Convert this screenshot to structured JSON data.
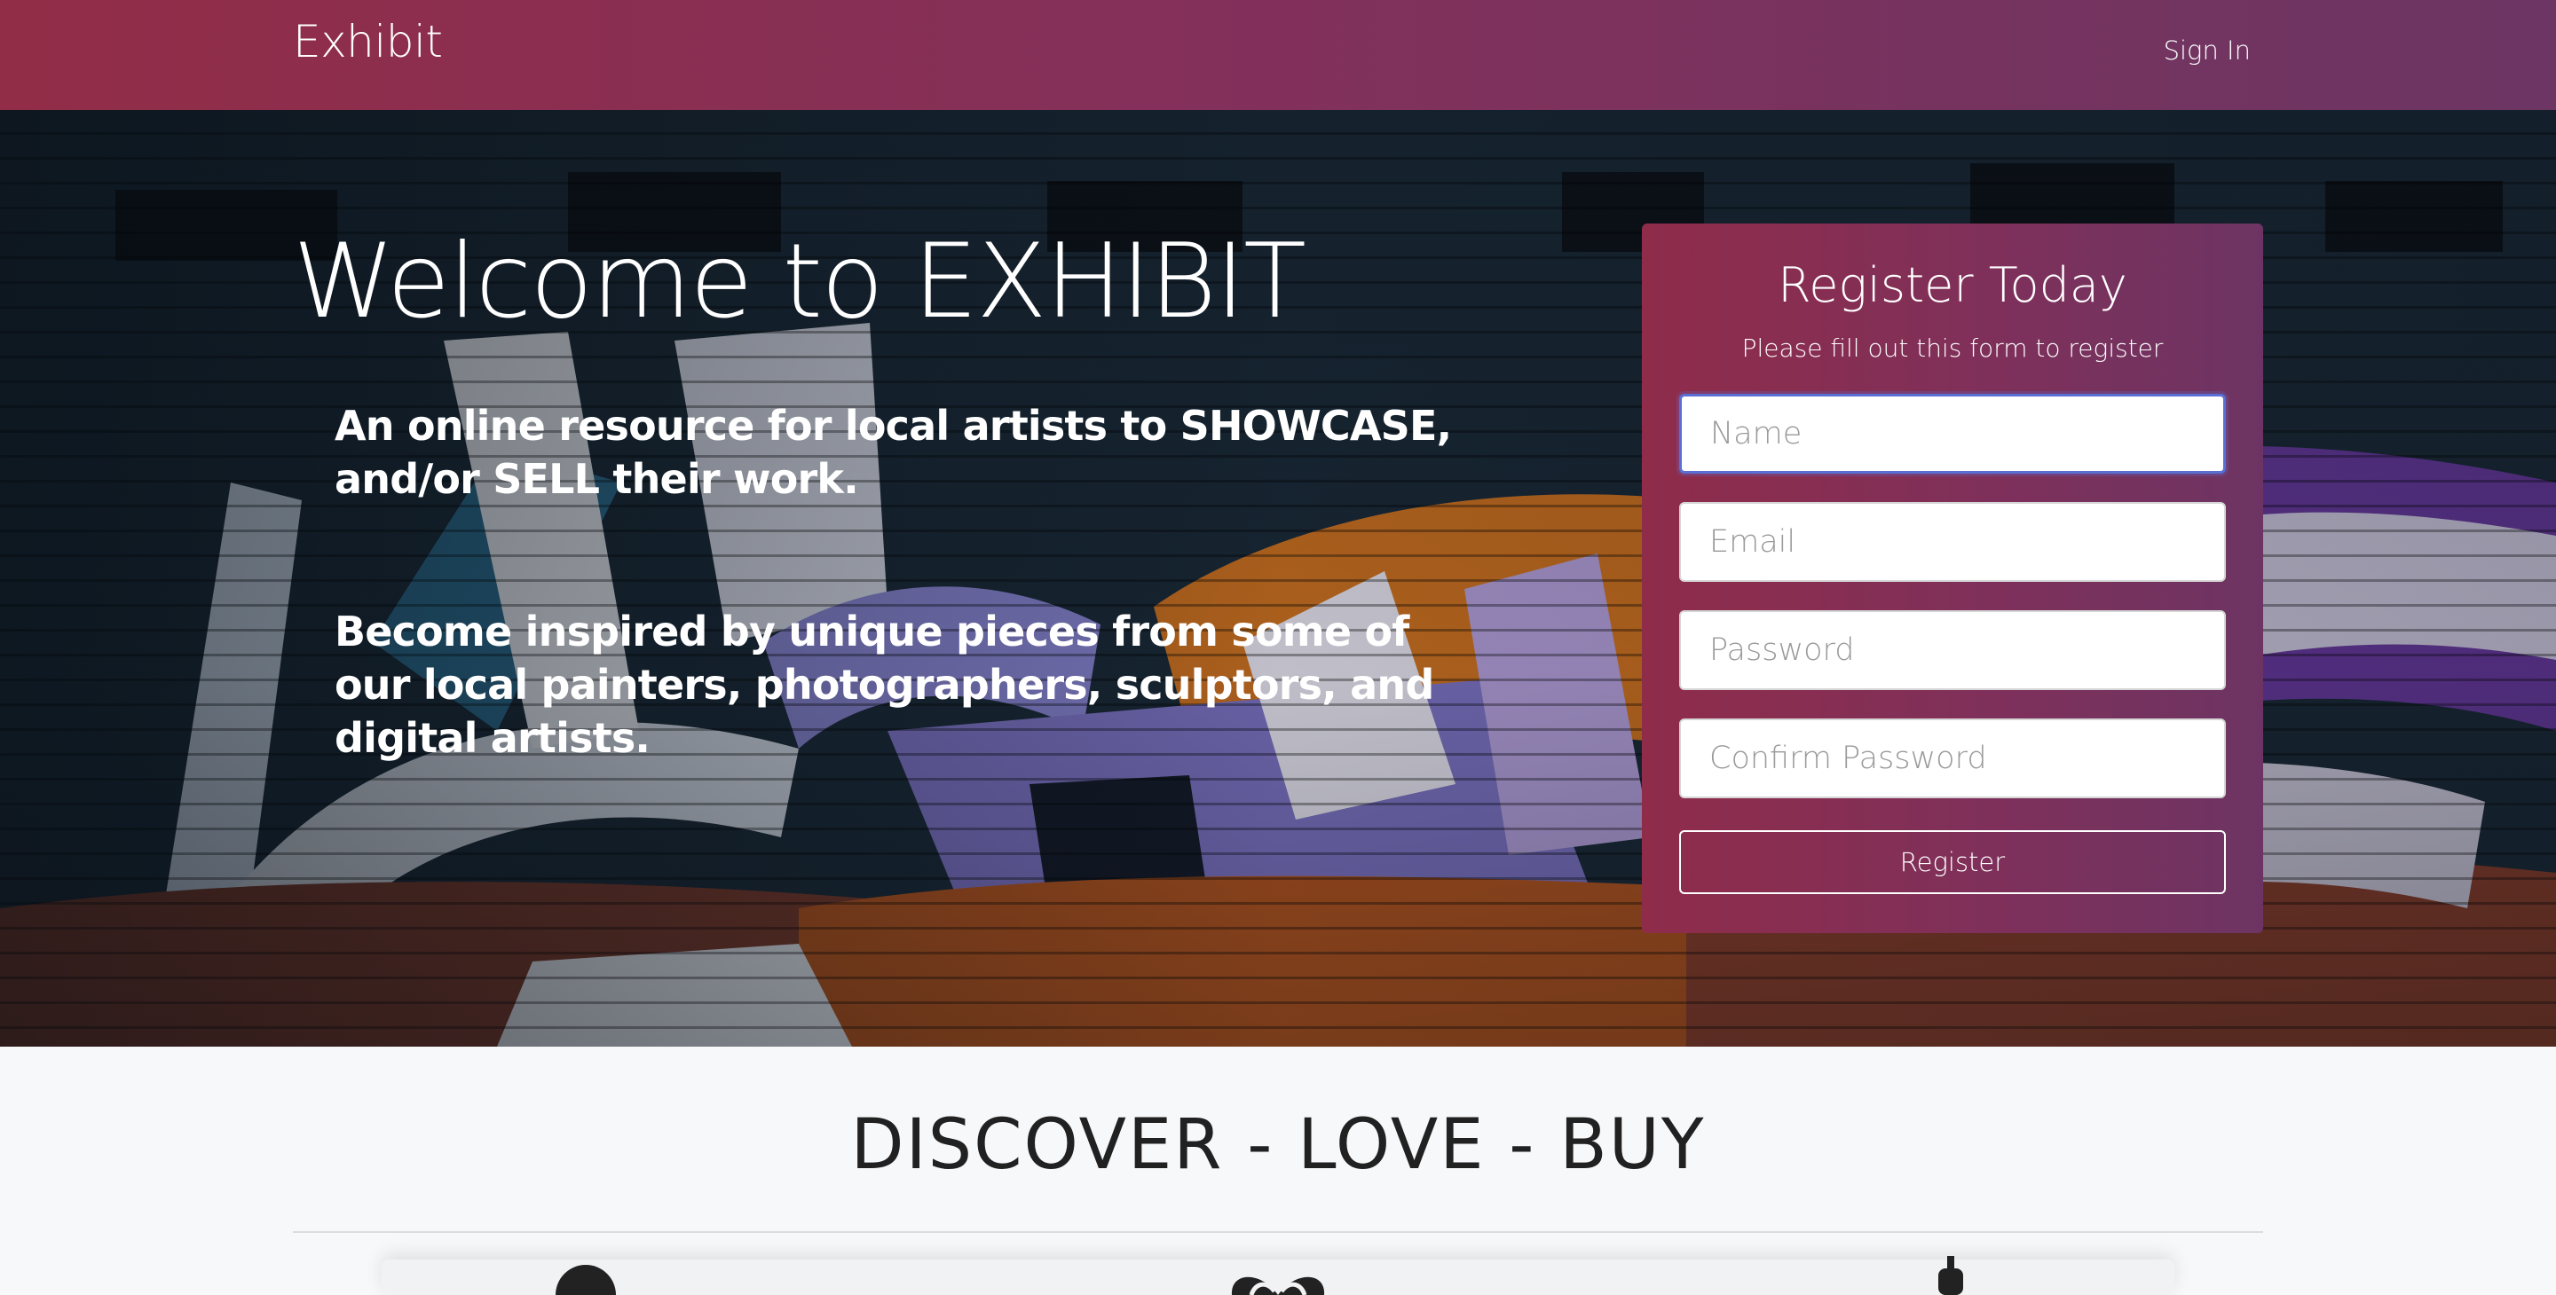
{
  "navbar": {
    "brand": "Exhibit",
    "sign_in": "Sign In"
  },
  "hero": {
    "title": "Welcome to EXHIBIT",
    "paragraph_1": "An online resource for local artists to SHOWCASE, and/or SELL their work.",
    "paragraph_2": "Become inspired by unique pieces from some of our local painters, photographers, sculptors, and digital artists."
  },
  "register": {
    "title": "Register Today",
    "subtitle": "Please fill out this form to register",
    "name_placeholder": "Name",
    "email_placeholder": "Email",
    "password_placeholder": "Password",
    "confirm_placeholder": "Confirm Password",
    "button": "Register"
  },
  "discover": {
    "title": "DISCOVER - LOVE - BUY",
    "icons": [
      "circle-icon",
      "heart-icon",
      "dollar-icon"
    ]
  },
  "colors": {
    "navbar_start": "#922d47",
    "navbar_end": "#6c3563",
    "card_start": "#8f2c4a",
    "card_end": "#6d3463",
    "focus_ring": "#5a6fd4",
    "section_bg": "#f7f8fa"
  }
}
